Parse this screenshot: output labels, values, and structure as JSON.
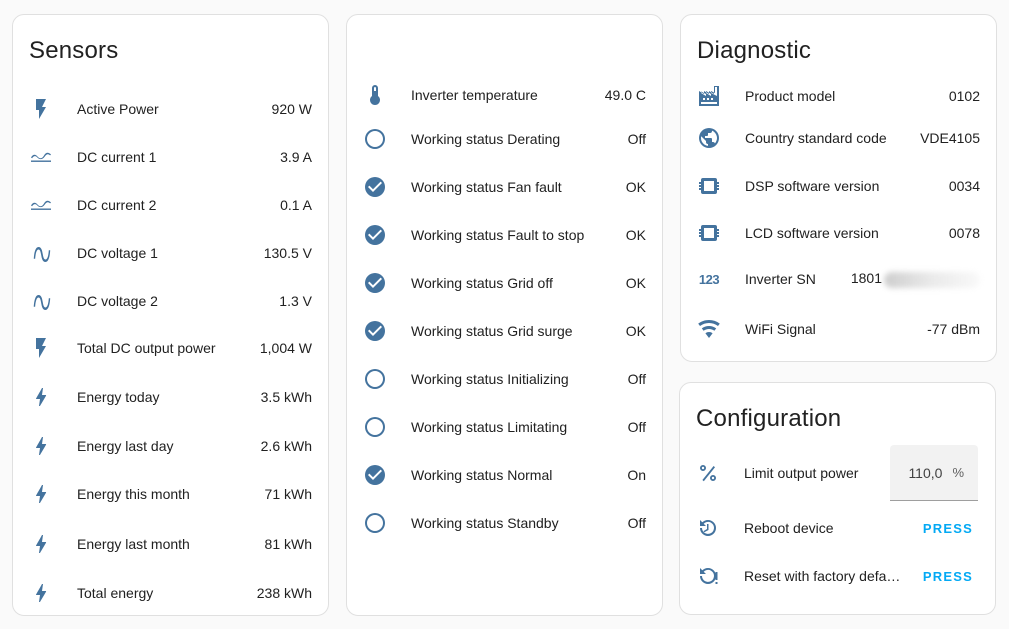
{
  "colors": {
    "icon": "#44739e",
    "accent": "#03a9f4",
    "card_bg": "#ffffff",
    "page_bg": "#fafafa"
  },
  "sensors": {
    "title": "Sensors",
    "rows": [
      {
        "icon": "flash-icon",
        "label": "Active Power",
        "value": "920 W"
      },
      {
        "icon": "current-dc-icon",
        "label": "DC current 1",
        "value": "3.9 A"
      },
      {
        "icon": "current-dc-icon",
        "label": "DC current 2",
        "value": "0.1 A"
      },
      {
        "icon": "sine-wave-icon",
        "label": "DC voltage 1",
        "value": "130.5 V"
      },
      {
        "icon": "sine-wave-icon",
        "label": "DC voltage 2",
        "value": "1.3 V"
      },
      {
        "icon": "flash-icon",
        "label": "Total DC output power",
        "value": "1,004 W"
      },
      {
        "icon": "lightning-icon",
        "label": "Energy today",
        "value": "3.5 kWh"
      },
      {
        "icon": "lightning-icon",
        "label": "Energy last day",
        "value": "2.6 kWh"
      },
      {
        "icon": "lightning-icon",
        "label": "Energy this month",
        "value": "71 kWh"
      },
      {
        "icon": "lightning-icon",
        "label": "Energy last month",
        "value": "81 kWh"
      },
      {
        "icon": "lightning-icon",
        "label": "Total energy",
        "value": "238 kWh"
      }
    ]
  },
  "status": {
    "rows": [
      {
        "icon": "thermometer-icon",
        "label": "Inverter temperature",
        "value": "49.0 C"
      },
      {
        "icon": "circle-outline-icon",
        "label": "Working status Derating",
        "value": "Off"
      },
      {
        "icon": "check-circle-icon",
        "label": "Working status Fan fault",
        "value": "OK"
      },
      {
        "icon": "check-circle-icon",
        "label": "Working status Fault to stop",
        "value": "OK"
      },
      {
        "icon": "check-circle-icon",
        "label": "Working status Grid off",
        "value": "OK"
      },
      {
        "icon": "check-circle-icon",
        "label": "Working status Grid surge",
        "value": "OK"
      },
      {
        "icon": "circle-outline-icon",
        "label": "Working status Initializing",
        "value": "Off"
      },
      {
        "icon": "circle-outline-icon",
        "label": "Working status Limitating",
        "value": "Off"
      },
      {
        "icon": "check-circle-icon",
        "label": "Working status Normal",
        "value": "On"
      },
      {
        "icon": "circle-outline-icon",
        "label": "Working status Standby",
        "value": "Off"
      }
    ]
  },
  "diagnostic": {
    "title": "Diagnostic",
    "rows": [
      {
        "icon": "factory-icon",
        "label": "Product model",
        "value": "0102"
      },
      {
        "icon": "globe-icon",
        "label": "Country standard code",
        "value": "VDE4105"
      },
      {
        "icon": "chip-icon",
        "label": "DSP software version",
        "value": "0034"
      },
      {
        "icon": "chip-icon",
        "label": "LCD software version",
        "value": "0078"
      },
      {
        "icon": "numeric-icon",
        "label": "Inverter SN",
        "value": "1801"
      },
      {
        "icon": "wifi-icon",
        "label": "WiFi Signal",
        "value": "-77 dBm"
      }
    ],
    "numeric_icon_text": "123"
  },
  "configuration": {
    "title": "Configuration",
    "limit": {
      "label": "Limit output power",
      "value": "110,0",
      "unit": "%"
    },
    "reboot": {
      "label": "Reboot device",
      "action": "PRESS"
    },
    "reset": {
      "label": "Reset with factory defa…",
      "action": "PRESS"
    }
  }
}
